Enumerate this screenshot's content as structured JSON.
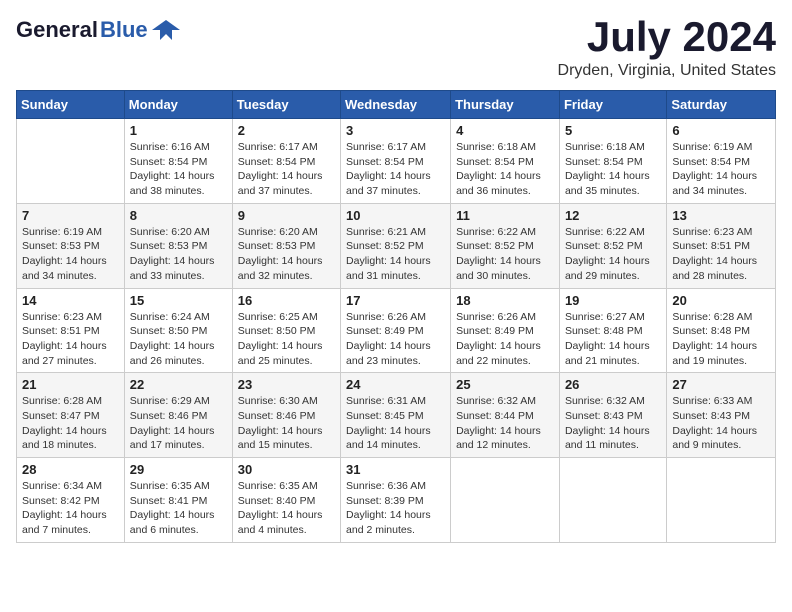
{
  "logo": {
    "general": "General",
    "blue": "Blue"
  },
  "title": "July 2024",
  "location": "Dryden, Virginia, United States",
  "days_of_week": [
    "Sunday",
    "Monday",
    "Tuesday",
    "Wednesday",
    "Thursday",
    "Friday",
    "Saturday"
  ],
  "weeks": [
    [
      {
        "day": "",
        "info": ""
      },
      {
        "day": "1",
        "info": "Sunrise: 6:16 AM\nSunset: 8:54 PM\nDaylight: 14 hours\nand 38 minutes."
      },
      {
        "day": "2",
        "info": "Sunrise: 6:17 AM\nSunset: 8:54 PM\nDaylight: 14 hours\nand 37 minutes."
      },
      {
        "day": "3",
        "info": "Sunrise: 6:17 AM\nSunset: 8:54 PM\nDaylight: 14 hours\nand 37 minutes."
      },
      {
        "day": "4",
        "info": "Sunrise: 6:18 AM\nSunset: 8:54 PM\nDaylight: 14 hours\nand 36 minutes."
      },
      {
        "day": "5",
        "info": "Sunrise: 6:18 AM\nSunset: 8:54 PM\nDaylight: 14 hours\nand 35 minutes."
      },
      {
        "day": "6",
        "info": "Sunrise: 6:19 AM\nSunset: 8:54 PM\nDaylight: 14 hours\nand 34 minutes."
      }
    ],
    [
      {
        "day": "7",
        "info": "Sunrise: 6:19 AM\nSunset: 8:53 PM\nDaylight: 14 hours\nand 34 minutes."
      },
      {
        "day": "8",
        "info": "Sunrise: 6:20 AM\nSunset: 8:53 PM\nDaylight: 14 hours\nand 33 minutes."
      },
      {
        "day": "9",
        "info": "Sunrise: 6:20 AM\nSunset: 8:53 PM\nDaylight: 14 hours\nand 32 minutes."
      },
      {
        "day": "10",
        "info": "Sunrise: 6:21 AM\nSunset: 8:52 PM\nDaylight: 14 hours\nand 31 minutes."
      },
      {
        "day": "11",
        "info": "Sunrise: 6:22 AM\nSunset: 8:52 PM\nDaylight: 14 hours\nand 30 minutes."
      },
      {
        "day": "12",
        "info": "Sunrise: 6:22 AM\nSunset: 8:52 PM\nDaylight: 14 hours\nand 29 minutes."
      },
      {
        "day": "13",
        "info": "Sunrise: 6:23 AM\nSunset: 8:51 PM\nDaylight: 14 hours\nand 28 minutes."
      }
    ],
    [
      {
        "day": "14",
        "info": "Sunrise: 6:23 AM\nSunset: 8:51 PM\nDaylight: 14 hours\nand 27 minutes."
      },
      {
        "day": "15",
        "info": "Sunrise: 6:24 AM\nSunset: 8:50 PM\nDaylight: 14 hours\nand 26 minutes."
      },
      {
        "day": "16",
        "info": "Sunrise: 6:25 AM\nSunset: 8:50 PM\nDaylight: 14 hours\nand 25 minutes."
      },
      {
        "day": "17",
        "info": "Sunrise: 6:26 AM\nSunset: 8:49 PM\nDaylight: 14 hours\nand 23 minutes."
      },
      {
        "day": "18",
        "info": "Sunrise: 6:26 AM\nSunset: 8:49 PM\nDaylight: 14 hours\nand 22 minutes."
      },
      {
        "day": "19",
        "info": "Sunrise: 6:27 AM\nSunset: 8:48 PM\nDaylight: 14 hours\nand 21 minutes."
      },
      {
        "day": "20",
        "info": "Sunrise: 6:28 AM\nSunset: 8:48 PM\nDaylight: 14 hours\nand 19 minutes."
      }
    ],
    [
      {
        "day": "21",
        "info": "Sunrise: 6:28 AM\nSunset: 8:47 PM\nDaylight: 14 hours\nand 18 minutes."
      },
      {
        "day": "22",
        "info": "Sunrise: 6:29 AM\nSunset: 8:46 PM\nDaylight: 14 hours\nand 17 minutes."
      },
      {
        "day": "23",
        "info": "Sunrise: 6:30 AM\nSunset: 8:46 PM\nDaylight: 14 hours\nand 15 minutes."
      },
      {
        "day": "24",
        "info": "Sunrise: 6:31 AM\nSunset: 8:45 PM\nDaylight: 14 hours\nand 14 minutes."
      },
      {
        "day": "25",
        "info": "Sunrise: 6:32 AM\nSunset: 8:44 PM\nDaylight: 14 hours\nand 12 minutes."
      },
      {
        "day": "26",
        "info": "Sunrise: 6:32 AM\nSunset: 8:43 PM\nDaylight: 14 hours\nand 11 minutes."
      },
      {
        "day": "27",
        "info": "Sunrise: 6:33 AM\nSunset: 8:43 PM\nDaylight: 14 hours\nand 9 minutes."
      }
    ],
    [
      {
        "day": "28",
        "info": "Sunrise: 6:34 AM\nSunset: 8:42 PM\nDaylight: 14 hours\nand 7 minutes."
      },
      {
        "day": "29",
        "info": "Sunrise: 6:35 AM\nSunset: 8:41 PM\nDaylight: 14 hours\nand 6 minutes."
      },
      {
        "day": "30",
        "info": "Sunrise: 6:35 AM\nSunset: 8:40 PM\nDaylight: 14 hours\nand 4 minutes."
      },
      {
        "day": "31",
        "info": "Sunrise: 6:36 AM\nSunset: 8:39 PM\nDaylight: 14 hours\nand 2 minutes."
      },
      {
        "day": "",
        "info": ""
      },
      {
        "day": "",
        "info": ""
      },
      {
        "day": "",
        "info": ""
      }
    ]
  ]
}
